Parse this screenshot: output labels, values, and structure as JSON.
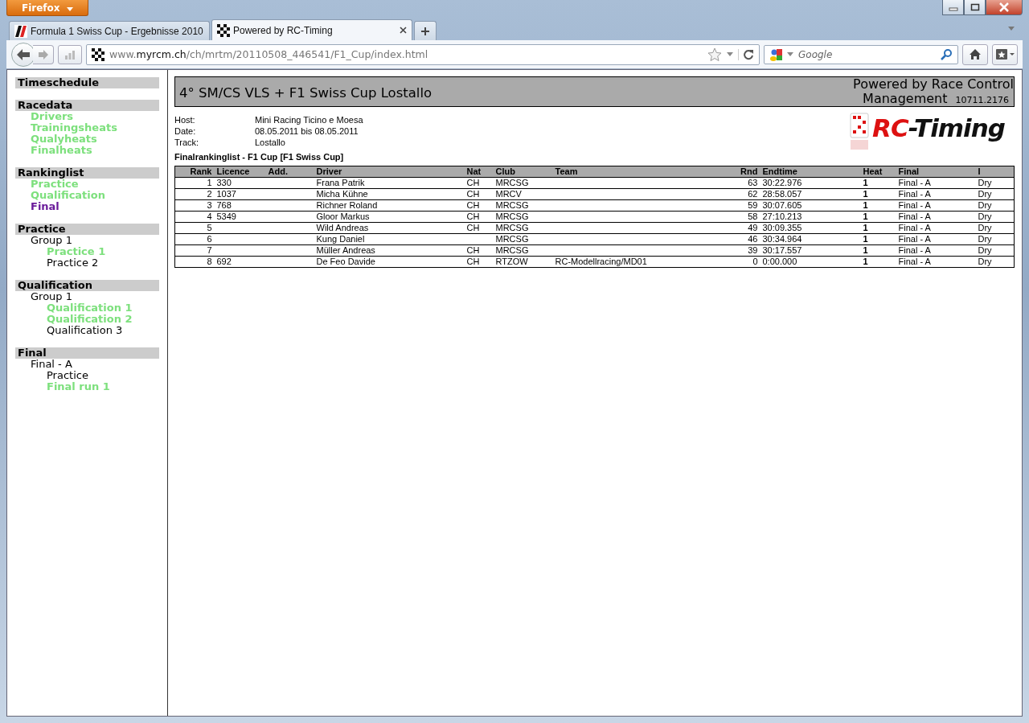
{
  "browser": {
    "menu_button": "Firefox",
    "tabs": [
      {
        "title": "Formula 1 Swiss Cup - Ergebnisse 2010",
        "selected": false,
        "kind": "f1"
      },
      {
        "title": "Powered by RC-Timing",
        "selected": true,
        "kind": "flag"
      }
    ],
    "url": "www.**myrcm.ch**/ch/mrtm/20110508_446541/F1_Cup/index.html",
    "search": {
      "placeholder": "Google"
    }
  },
  "sidebar": [
    {
      "heading": "Timeschedule"
    },
    {
      "heading": "Racedata",
      "items": [
        {
          "label": "Drivers",
          "kind": "visited"
        },
        {
          "label": "Trainingsheats",
          "kind": "visited"
        },
        {
          "label": "Qualyheats",
          "kind": "visited"
        },
        {
          "label": "Finalheats",
          "kind": "visited"
        }
      ]
    },
    {
      "heading": "Rankinglist",
      "items": [
        {
          "label": "Practice",
          "kind": "visited"
        },
        {
          "label": "Qualification",
          "kind": "visited"
        },
        {
          "label": "Final",
          "kind": "current"
        }
      ]
    },
    {
      "heading": "Practice",
      "items": [
        {
          "label": "Group 1",
          "kind": "plain",
          "children": [
            {
              "label": "Practice 1",
              "kind": "visited"
            },
            {
              "label": "Practice 2",
              "kind": "plain"
            }
          ]
        }
      ]
    },
    {
      "heading": "Qualification",
      "items": [
        {
          "label": "Group 1",
          "kind": "plain",
          "children": [
            {
              "label": "Qualification 1",
              "kind": "visited"
            },
            {
              "label": "Qualification 2",
              "kind": "visited"
            },
            {
              "label": "Qualification 3",
              "kind": "plain"
            }
          ]
        }
      ]
    },
    {
      "heading": "Final",
      "items": [
        {
          "label": "Final - A",
          "kind": "plain",
          "children": [
            {
              "label": "Practice",
              "kind": "plain"
            },
            {
              "label": "Final run 1",
              "kind": "visited"
            }
          ]
        }
      ]
    }
  ],
  "header": {
    "title": "4° SM/CS VLS + F1 Swiss Cup Lostallo",
    "powered_by": "Powered by Race Control",
    "powered_by_2": "Management",
    "version": "10711.2176"
  },
  "info": [
    {
      "label": "Host:",
      "value": "Mini Racing Ticino e Moesa"
    },
    {
      "label": "Date:",
      "value": "08.05.2011 bis 08.05.2011"
    },
    {
      "label": "Track:",
      "value": "Lostallo"
    }
  ],
  "logo": {
    "mark": "RC",
    "rest": "-Timing"
  },
  "table": {
    "title": "Finalrankinglist  -  F1 Cup [F1 Swiss Cup]",
    "columns": [
      "Rank",
      "Licence",
      "Add.",
      "Driver",
      "Nat",
      "Club",
      "Team",
      "Rnd",
      "Endtime",
      "Heat",
      "Final",
      "I"
    ],
    "rows": [
      [
        "1",
        "330",
        "",
        "Frana Patrik",
        "CH",
        "MRCSG",
        "",
        "63",
        "30:22.976",
        "1",
        "Final - A",
        "Dry"
      ],
      [
        "2",
        "1037",
        "",
        "Micha Kühne",
        "CH",
        "MRCV",
        "",
        "62",
        "28:58.057",
        "1",
        "Final - A",
        "Dry"
      ],
      [
        "3",
        "768",
        "",
        "Richner Roland",
        "CH",
        "MRCSG",
        "",
        "59",
        "30:07.605",
        "1",
        "Final - A",
        "Dry"
      ],
      [
        "4",
        "5349",
        "",
        "Gloor Markus",
        "CH",
        "MRCSG",
        "",
        "58",
        "27:10.213",
        "1",
        "Final - A",
        "Dry"
      ],
      [
        "5",
        "",
        "",
        "Wild Andreas",
        "CH",
        "MRCSG",
        "",
        "49",
        "30:09.355",
        "1",
        "Final - A",
        "Dry"
      ],
      [
        "6",
        "",
        "",
        "Kung Daniel",
        "",
        "MRCSG",
        "",
        "46",
        "30:34.964",
        "1",
        "Final - A",
        "Dry"
      ],
      [
        "7",
        "",
        "",
        "Müller Andreas",
        "CH",
        "MRCSG",
        "",
        "39",
        "30:17.557",
        "1",
        "Final - A",
        "Dry"
      ],
      [
        "8",
        "692",
        "",
        "De Feo Davide",
        "CH",
        "RTZOW",
        "RC-Modellracing/MD01",
        "0",
        "0:00.000",
        "1",
        "Final - A",
        "Dry"
      ]
    ]
  }
}
